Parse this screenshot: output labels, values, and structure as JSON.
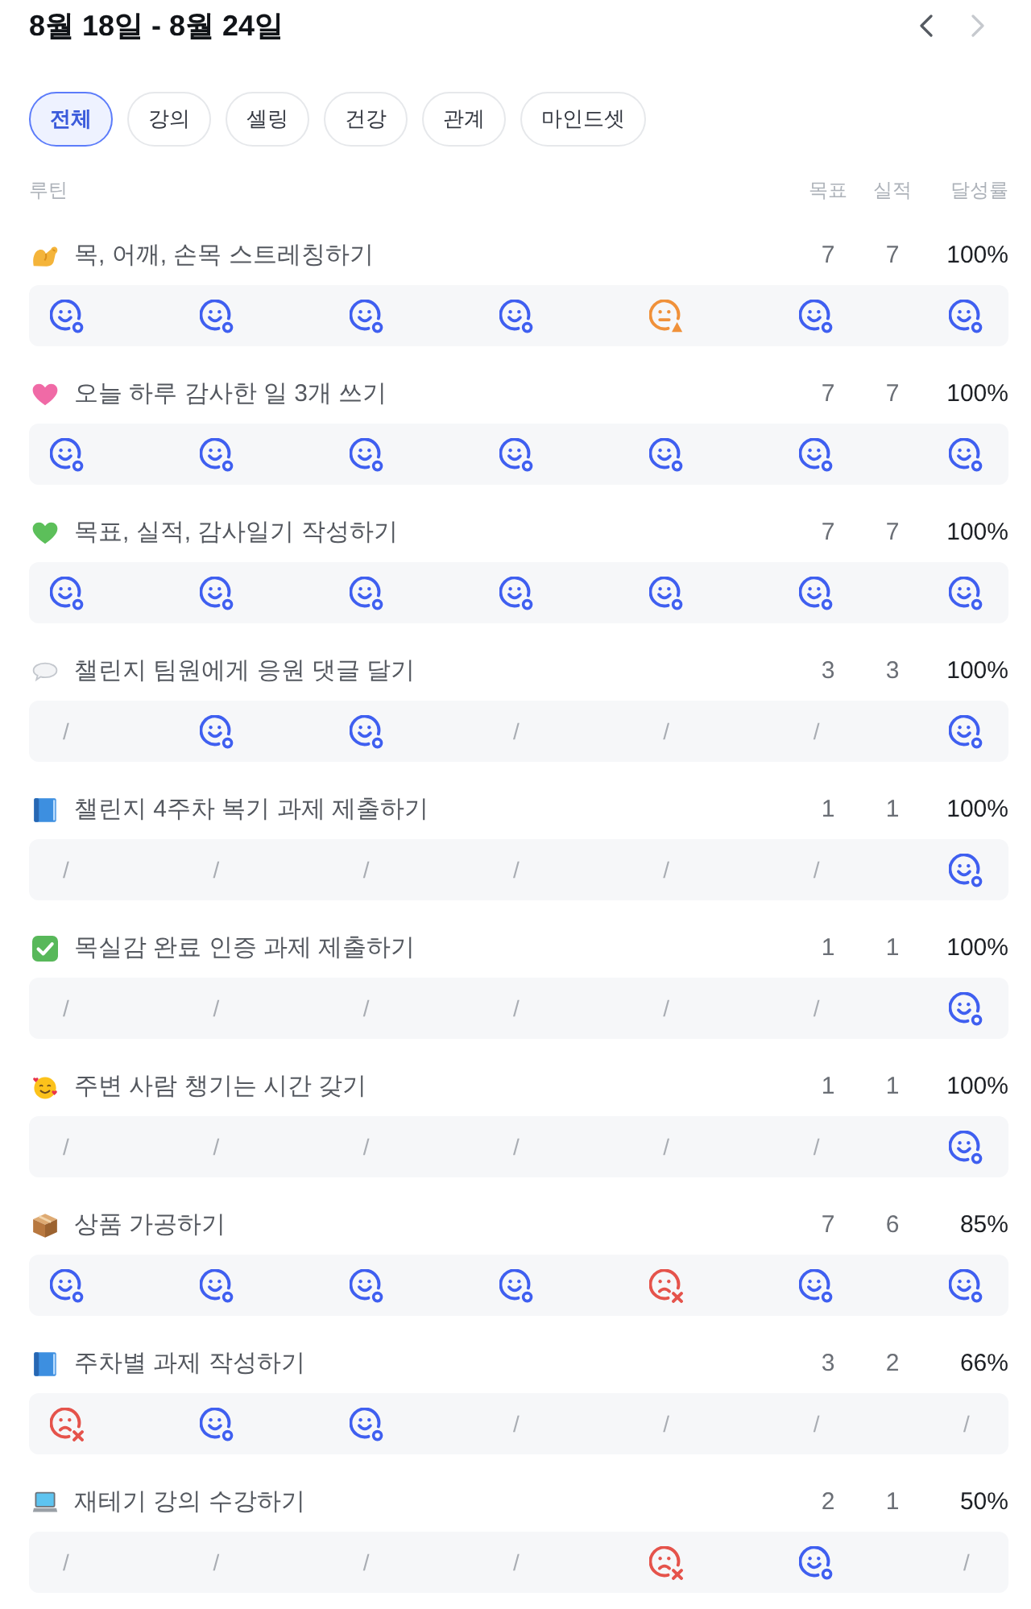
{
  "header": {
    "title": "8월 18일 - 8월 24일",
    "prev": {
      "disabled": false
    },
    "next": {
      "disabled": true
    }
  },
  "tabs": [
    {
      "label": "전체",
      "selected": true
    },
    {
      "label": "강의",
      "selected": false
    },
    {
      "label": "셀링",
      "selected": false
    },
    {
      "label": "건강",
      "selected": false
    },
    {
      "label": "관계",
      "selected": false
    },
    {
      "label": "마인드셋",
      "selected": false
    }
  ],
  "columns": {
    "routine": "루틴",
    "goal": "목표",
    "actual": "실적",
    "rate": "달성률"
  },
  "routines": [
    {
      "kind": "muscle",
      "name": "목, 어깨, 손목 스트레칭하기",
      "goal": "7",
      "actual": "7",
      "rate": "100%",
      "days": [
        {
          "kind": "done"
        },
        {
          "kind": "done"
        },
        {
          "kind": "done"
        },
        {
          "kind": "done"
        },
        {
          "kind": "partial"
        },
        {
          "kind": "done"
        },
        {
          "kind": "done"
        }
      ]
    },
    {
      "kind": "heart",
      "color": "#f06aa6",
      "name": "오늘 하루 감사한 일 3개 쓰기",
      "goal": "7",
      "actual": "7",
      "rate": "100%",
      "days": [
        {
          "kind": "done"
        },
        {
          "kind": "done"
        },
        {
          "kind": "done"
        },
        {
          "kind": "done"
        },
        {
          "kind": "done"
        },
        {
          "kind": "done"
        },
        {
          "kind": "done"
        }
      ]
    },
    {
      "kind": "heart",
      "color": "#5cbf5a",
      "name": "목표, 실적, 감사일기 작성하기",
      "goal": "7",
      "actual": "7",
      "rate": "100%",
      "days": [
        {
          "kind": "done"
        },
        {
          "kind": "done"
        },
        {
          "kind": "done"
        },
        {
          "kind": "done"
        },
        {
          "kind": "done"
        },
        {
          "kind": "done"
        },
        {
          "kind": "done"
        }
      ]
    },
    {
      "kind": "speech",
      "name": "챌린지 팀원에게 응원 댓글 달기",
      "goal": "3",
      "actual": "3",
      "rate": "100%",
      "days": [
        {
          "kind": "none",
          "text": "/"
        },
        {
          "kind": "done"
        },
        {
          "kind": "done"
        },
        {
          "kind": "none",
          "text": "/"
        },
        {
          "kind": "none",
          "text": "/"
        },
        {
          "kind": "none",
          "text": "/"
        },
        {
          "kind": "done"
        }
      ]
    },
    {
      "kind": "book",
      "name": "챌린지 4주차 복기 과제 제출하기",
      "goal": "1",
      "actual": "1",
      "rate": "100%",
      "days": [
        {
          "kind": "none",
          "text": "/"
        },
        {
          "kind": "none",
          "text": "/"
        },
        {
          "kind": "none",
          "text": "/"
        },
        {
          "kind": "none",
          "text": "/"
        },
        {
          "kind": "none",
          "text": "/"
        },
        {
          "kind": "none",
          "text": "/"
        },
        {
          "kind": "done"
        }
      ]
    },
    {
      "kind": "check",
      "name": "목실감 완료 인증 과제 제출하기",
      "goal": "1",
      "actual": "1",
      "rate": "100%",
      "days": [
        {
          "kind": "none",
          "text": "/"
        },
        {
          "kind": "none",
          "text": "/"
        },
        {
          "kind": "none",
          "text": "/"
        },
        {
          "kind": "none",
          "text": "/"
        },
        {
          "kind": "none",
          "text": "/"
        },
        {
          "kind": "none",
          "text": "/"
        },
        {
          "kind": "done"
        }
      ]
    },
    {
      "kind": "lovingface",
      "name": "주변 사람 챙기는 시간 갖기",
      "goal": "1",
      "actual": "1",
      "rate": "100%",
      "days": [
        {
          "kind": "none",
          "text": "/"
        },
        {
          "kind": "none",
          "text": "/"
        },
        {
          "kind": "none",
          "text": "/"
        },
        {
          "kind": "none",
          "text": "/"
        },
        {
          "kind": "none",
          "text": "/"
        },
        {
          "kind": "none",
          "text": "/"
        },
        {
          "kind": "done"
        }
      ]
    },
    {
      "kind": "package",
      "name": "상품 가공하기",
      "goal": "7",
      "actual": "6",
      "rate": "85%",
      "days": [
        {
          "kind": "done"
        },
        {
          "kind": "done"
        },
        {
          "kind": "done"
        },
        {
          "kind": "done"
        },
        {
          "kind": "missed"
        },
        {
          "kind": "done"
        },
        {
          "kind": "done"
        }
      ]
    },
    {
      "kind": "book",
      "name": "주차별 과제 작성하기",
      "goal": "3",
      "actual": "2",
      "rate": "66%",
      "days": [
        {
          "kind": "missed"
        },
        {
          "kind": "done"
        },
        {
          "kind": "done"
        },
        {
          "kind": "none",
          "text": "/"
        },
        {
          "kind": "none",
          "text": "/"
        },
        {
          "kind": "none",
          "text": "/"
        },
        {
          "kind": "none",
          "text": "/"
        }
      ]
    },
    {
      "kind": "laptop",
      "name": "재테기 강의 수강하기",
      "goal": "2",
      "actual": "1",
      "rate": "50%",
      "days": [
        {
          "kind": "none",
          "text": "/"
        },
        {
          "kind": "none",
          "text": "/"
        },
        {
          "kind": "none",
          "text": "/"
        },
        {
          "kind": "none",
          "text": "/"
        },
        {
          "kind": "missed"
        },
        {
          "kind": "done"
        },
        {
          "kind": "none",
          "text": "/"
        }
      ]
    }
  ]
}
